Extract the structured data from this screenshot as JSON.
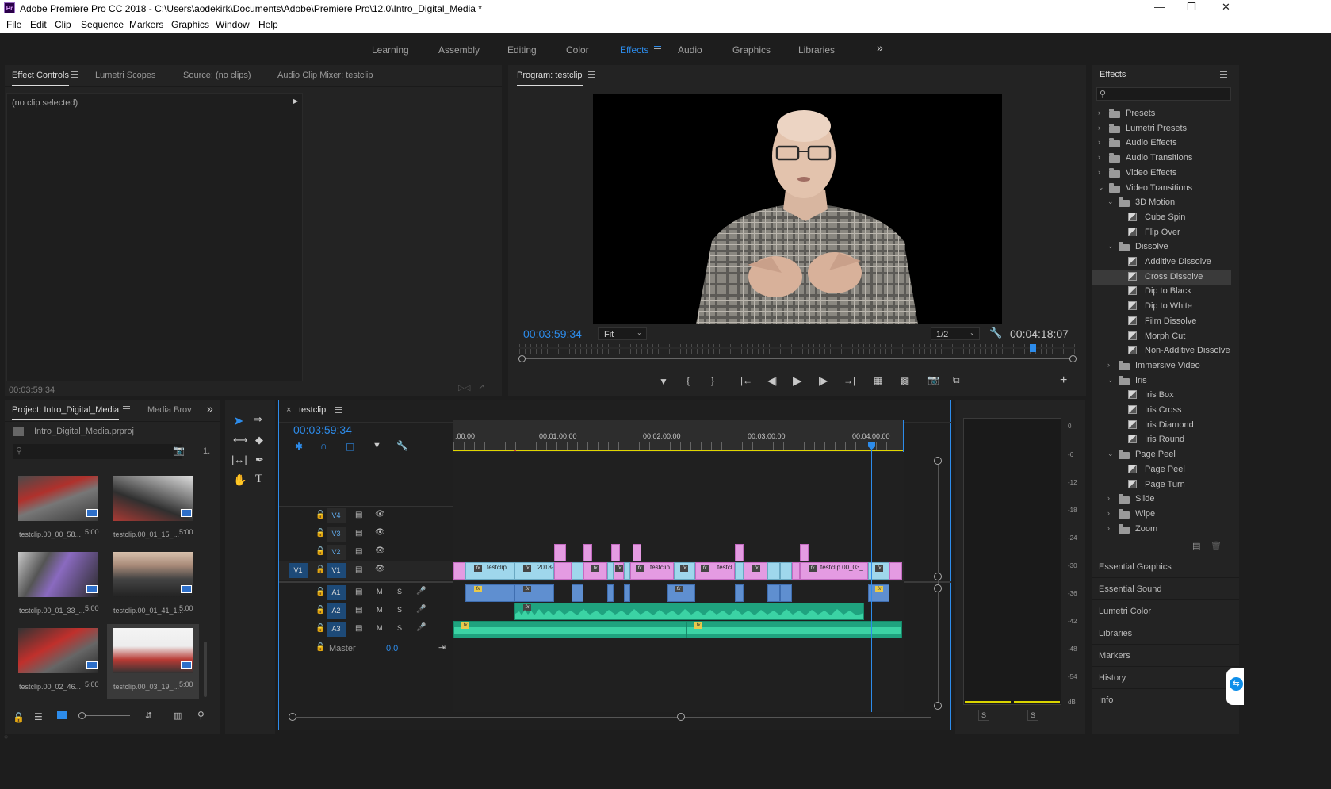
{
  "app": {
    "title": "Adobe Premiere Pro CC 2018 - C:\\Users\\aodekirk\\Documents\\Adobe\\Premiere Pro\\12.0\\Intro_Digital_Media *",
    "icon_text": "Pr"
  },
  "window_controls": [
    "minimize-icon",
    "restore-icon",
    "close-icon"
  ],
  "menu": [
    "File",
    "Edit",
    "Clip",
    "Sequence",
    "Markers",
    "Graphics",
    "Window",
    "Help"
  ],
  "workspaces": {
    "items": [
      "Learning",
      "Assembly",
      "Editing",
      "Color",
      "Effects",
      "Audio",
      "Graphics",
      "Libraries"
    ],
    "active": "Effects",
    "more": "»"
  },
  "effect_controls": {
    "tabs": [
      "Effect Controls",
      "Lumetri Scopes",
      "Source: (no clips)",
      "Audio Clip Mixer: testclip"
    ],
    "active_tab": "Effect Controls",
    "no_clip": "(no clip selected)",
    "timecode": "00:03:59:34"
  },
  "program": {
    "title": "Program: testclip",
    "timecode_current": "00:03:59:34",
    "fit": "Fit",
    "resolution": "1/2",
    "timecode_duration": "00:04:18:07",
    "playhead_pct": 92.5,
    "controls": [
      "marker-icon",
      "mark-in-icon",
      "mark-out-icon",
      "go-to-in-icon",
      "step-back-icon",
      "play-icon",
      "step-forward-icon",
      "go-to-out-icon",
      "lift-icon",
      "extract-icon",
      "export-frame-icon",
      "comparison-view-icon",
      "add-button-icon"
    ]
  },
  "project": {
    "tabs": [
      "Project: Intro_Digital_Media",
      "Media Brov"
    ],
    "file": "Intro_Digital_Media.prproj",
    "item_count": "1.",
    "clips": [
      {
        "name": "testclip.00_00_58...",
        "dur": "5:00"
      },
      {
        "name": "testclip.00_01_15_...",
        "dur": "5:00"
      },
      {
        "name": "testclip.00_01_33_...",
        "dur": "5:00"
      },
      {
        "name": "testclip.00_01_41_1...",
        "dur": "5:00"
      },
      {
        "name": "testclip.00_02_46...",
        "dur": "5:00"
      },
      {
        "name": "testclip.00_03_19_...",
        "dur": "5:00"
      }
    ]
  },
  "timeline": {
    "tab": "testclip",
    "timecode": "00:03:59:34",
    "ruler": [
      ":00:00",
      "00:01:00:00",
      "00:02:00:00",
      "00:03:00:00",
      "00:04:00:00"
    ],
    "playhead_tc": "00:03:59:34",
    "video_tracks": [
      "V4",
      "V3",
      "V2",
      "V1"
    ],
    "audio_tracks": [
      "A1",
      "A2",
      "A3"
    ],
    "source_v": "V1",
    "source_a": "A1",
    "master_label": "Master",
    "master_value": "0.0",
    "mute": "M",
    "solo": "S",
    "clip_labels": [
      "testclip",
      "2018-",
      "testclip.",
      "testcl",
      "testclip.00_03_"
    ]
  },
  "meter": {
    "labels": [
      "0",
      "-6",
      "-12",
      "-18",
      "-24",
      "-30",
      "-36",
      "-42",
      "-48",
      "-54",
      "dB"
    ],
    "solo_buttons": [
      "S",
      "S"
    ]
  },
  "effects": {
    "title": "Effects",
    "search_placeholder": "",
    "tree": [
      {
        "label": "Presets",
        "type": "special-folder",
        "level": 0,
        "open": false
      },
      {
        "label": "Lumetri Presets",
        "type": "special-folder",
        "level": 0,
        "open": false
      },
      {
        "label": "Audio Effects",
        "type": "folder",
        "level": 0,
        "open": false
      },
      {
        "label": "Audio Transitions",
        "type": "folder",
        "level": 0,
        "open": false
      },
      {
        "label": "Video Effects",
        "type": "folder",
        "level": 0,
        "open": false
      },
      {
        "label": "Video Transitions",
        "type": "folder",
        "level": 0,
        "open": true
      },
      {
        "label": "3D Motion",
        "type": "folder",
        "level": 1,
        "open": true
      },
      {
        "label": "Cube Spin",
        "type": "item",
        "level": 2
      },
      {
        "label": "Flip Over",
        "type": "item",
        "level": 2
      },
      {
        "label": "Dissolve",
        "type": "folder",
        "level": 1,
        "open": true
      },
      {
        "label": "Additive Dissolve",
        "type": "item",
        "level": 2
      },
      {
        "label": "Cross Dissolve",
        "type": "item",
        "level": 2,
        "selected": true
      },
      {
        "label": "Dip to Black",
        "type": "item",
        "level": 2
      },
      {
        "label": "Dip to White",
        "type": "item",
        "level": 2
      },
      {
        "label": "Film Dissolve",
        "type": "item",
        "level": 2
      },
      {
        "label": "Morph Cut",
        "type": "item",
        "level": 2
      },
      {
        "label": "Non-Additive Dissolve",
        "type": "item",
        "level": 2
      },
      {
        "label": "Immersive Video",
        "type": "folder",
        "level": 1,
        "open": false
      },
      {
        "label": "Iris",
        "type": "folder",
        "level": 1,
        "open": true
      },
      {
        "label": "Iris Box",
        "type": "item",
        "level": 2
      },
      {
        "label": "Iris Cross",
        "type": "item",
        "level": 2
      },
      {
        "label": "Iris Diamond",
        "type": "item",
        "level": 2
      },
      {
        "label": "Iris Round",
        "type": "item",
        "level": 2
      },
      {
        "label": "Page Peel",
        "type": "folder",
        "level": 1,
        "open": true
      },
      {
        "label": "Page Peel",
        "type": "item",
        "level": 2
      },
      {
        "label": "Page Turn",
        "type": "item",
        "level": 2
      },
      {
        "label": "Slide",
        "type": "folder",
        "level": 1,
        "open": false
      },
      {
        "label": "Wipe",
        "type": "folder",
        "level": 1,
        "open": false
      },
      {
        "label": "Zoom",
        "type": "folder",
        "level": 1,
        "open": false
      }
    ]
  },
  "side_panels": [
    "Essential Graphics",
    "Essential Sound",
    "Lumetri Color",
    "Libraries",
    "Markers",
    "History",
    "Info"
  ],
  "colors": {
    "accent": "#2d8ceb",
    "video_clip": "#9fd7ec",
    "pink_clip": "#e49be2",
    "audio_clip": "#5f8fd0",
    "waveform": "#3bd3a4"
  }
}
